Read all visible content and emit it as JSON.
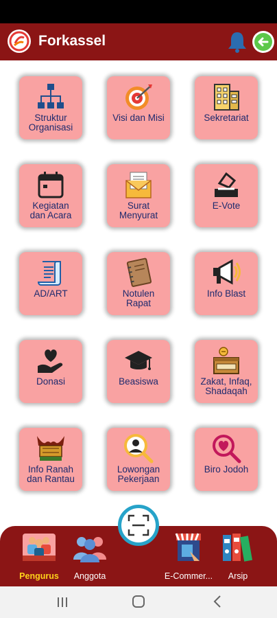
{
  "app": {
    "title": "Forkassel",
    "bell_icon": "bell-icon",
    "back_icon": "arrow-left-circle-icon",
    "brand_color": "#8b1515",
    "tile_color": "#f9a2a2",
    "label_color": "#1e2a6e",
    "active_color": "#ffd21a"
  },
  "menu": [
    {
      "label": "Struktur\nOrganisasi",
      "icon": "org-chart-icon"
    },
    {
      "label": "Visi dan Misi",
      "icon": "target-icon"
    },
    {
      "label": "Sekretariat",
      "icon": "building-icon"
    },
    {
      "label": "Kegiatan\ndan Acara",
      "icon": "calendar-icon"
    },
    {
      "label": "Surat\nMenyurat",
      "icon": "envelope-icon"
    },
    {
      "label": "E-Vote",
      "icon": "ballot-box-icon"
    },
    {
      "label": "AD/ART",
      "icon": "scroll-icon"
    },
    {
      "label": "Notulen\nRapat",
      "icon": "notebook-icon"
    },
    {
      "label": "Info Blast",
      "icon": "megaphone-icon"
    },
    {
      "label": "Donasi",
      "icon": "heart-hand-icon"
    },
    {
      "label": "Beasiswa",
      "icon": "graduation-cap-icon"
    },
    {
      "label": "Zakat, Infaq,\nShadaqah",
      "icon": "zakat-box-icon"
    },
    {
      "label": "Info Ranah\ndan Rantau",
      "icon": "rumah-gadang-icon"
    },
    {
      "label": "Lowongan\nPekerjaan",
      "icon": "job-search-icon"
    },
    {
      "label": "Biro Jodoh",
      "icon": "heart-search-icon"
    }
  ],
  "bottom_nav": [
    {
      "label": "Pengurus",
      "icon": "pengurus-icon",
      "active": true
    },
    {
      "label": "Anggota",
      "icon": "members-icon",
      "active": false
    },
    {
      "label": "E-Commer...",
      "icon": "shop-icon",
      "active": false
    },
    {
      "label": "Arsip",
      "icon": "binders-icon",
      "active": false
    }
  ],
  "scan": {
    "icon": "scan-icon"
  },
  "system_nav": {
    "recent_icon": "recent-apps-icon",
    "home_icon": "home-icon",
    "back_icon": "chevron-left-icon"
  }
}
